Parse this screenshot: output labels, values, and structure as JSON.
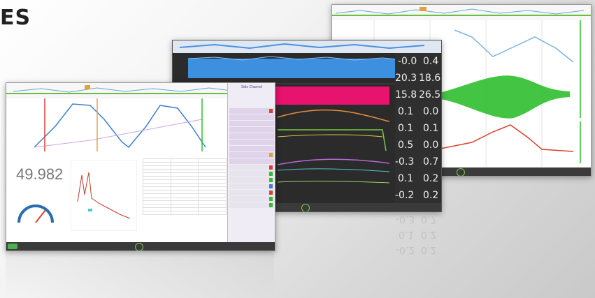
{
  "heading": "ES",
  "win_center": {
    "readouts": [
      [
        "-0.0",
        "0.4"
      ],
      [
        "20.3",
        "18.6"
      ],
      [
        "15.8",
        "26.5"
      ],
      [
        "0.1",
        "0.0"
      ],
      [
        "0.1",
        "0.1"
      ],
      [
        "0.5",
        "0.0"
      ],
      [
        "-0.3",
        "0.7"
      ],
      [
        "0.1",
        "0.2"
      ],
      [
        "-0.2",
        "0.2"
      ]
    ],
    "reflection": [
      "-0.3",
      "0.7",
      "0.1",
      "0.2",
      "-0.2",
      "0.2"
    ]
  },
  "win_front": {
    "big_value": "49.982",
    "sidebar_title": "Side Channel"
  },
  "colors": {
    "blue": "#4a90e2",
    "pink": "#e8126f",
    "green": "#2fbf2f",
    "red": "#d9412f",
    "dark_bg": "#2b2b2b"
  }
}
